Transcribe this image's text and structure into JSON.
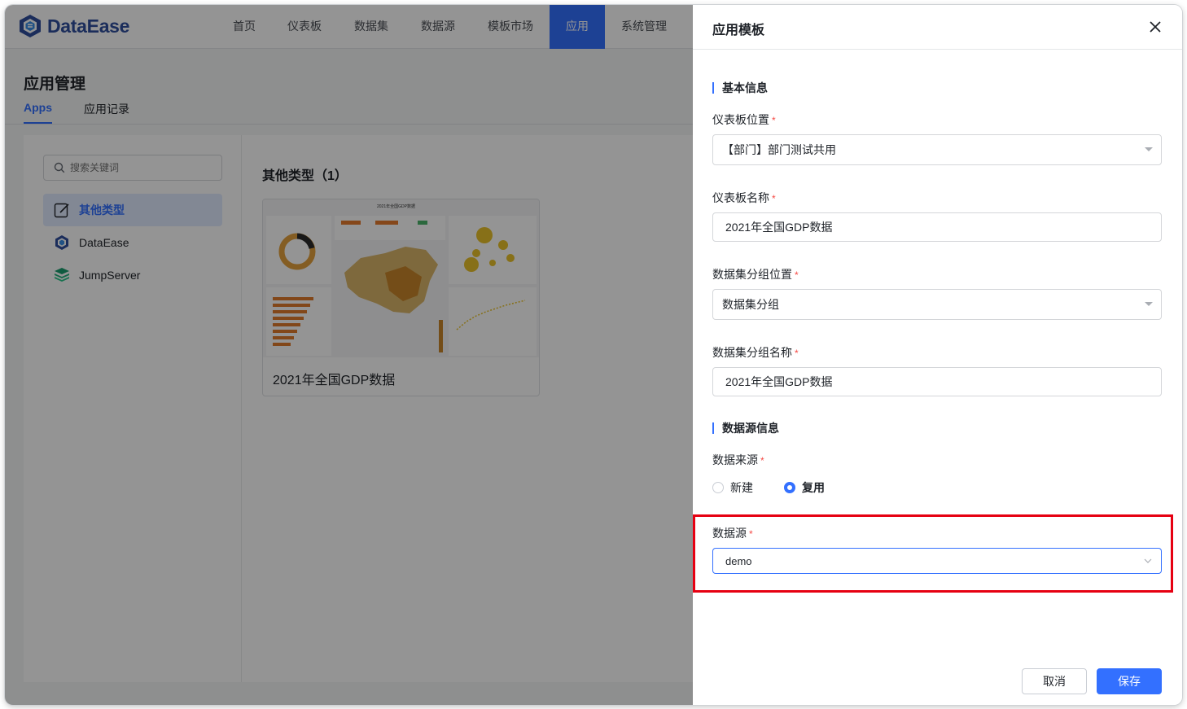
{
  "brand": {
    "name": "DataEase",
    "color": "#2f4f9e"
  },
  "topnav": {
    "items": [
      {
        "label": "首页"
      },
      {
        "label": "仪表板"
      },
      {
        "label": "数据集"
      },
      {
        "label": "数据源"
      },
      {
        "label": "模板市场"
      },
      {
        "label": "应用",
        "active": true
      },
      {
        "label": "系统管理"
      }
    ]
  },
  "page": {
    "title": "应用管理",
    "tabs": [
      {
        "label": "Apps",
        "active": true
      },
      {
        "label": "应用记录"
      }
    ]
  },
  "sidebar": {
    "search_placeholder": "搜索关键词",
    "items": [
      {
        "label": "其他类型",
        "icon": "edit-note-icon",
        "active": true
      },
      {
        "label": "DataEase",
        "icon": "dataease-logo-icon"
      },
      {
        "label": "JumpServer",
        "icon": "jumpserver-logo-icon"
      }
    ]
  },
  "main": {
    "section_title": "其他类型（1）",
    "cards": [
      {
        "name": "2021年全国GDP数据",
        "thumb_title": "2021年全国GDP数据"
      }
    ]
  },
  "drawer": {
    "title": "应用模板",
    "basic_section": "基本信息",
    "dashboard_location": {
      "label": "仪表板位置",
      "value": "【部门】部门测试共用"
    },
    "dashboard_name": {
      "label": "仪表板名称",
      "value": "2021年全国GDP数据"
    },
    "dataset_group_location": {
      "label": "数据集分组位置",
      "value": "数据集分组"
    },
    "dataset_group_name": {
      "label": "数据集分组名称",
      "value": "2021年全国GDP数据"
    },
    "datasource_section": "数据源信息",
    "data_source_origin": {
      "label": "数据来源",
      "options": [
        {
          "label": "新建",
          "checked": false
        },
        {
          "label": "复用",
          "checked": true
        }
      ]
    },
    "datasource": {
      "label": "数据源",
      "value": "demo"
    },
    "required_mark": "*",
    "cancel_label": "取消",
    "save_label": "保存"
  },
  "colors": {
    "accent": "#3370ff",
    "highlight": "#e60012",
    "required": "#f54a45"
  }
}
